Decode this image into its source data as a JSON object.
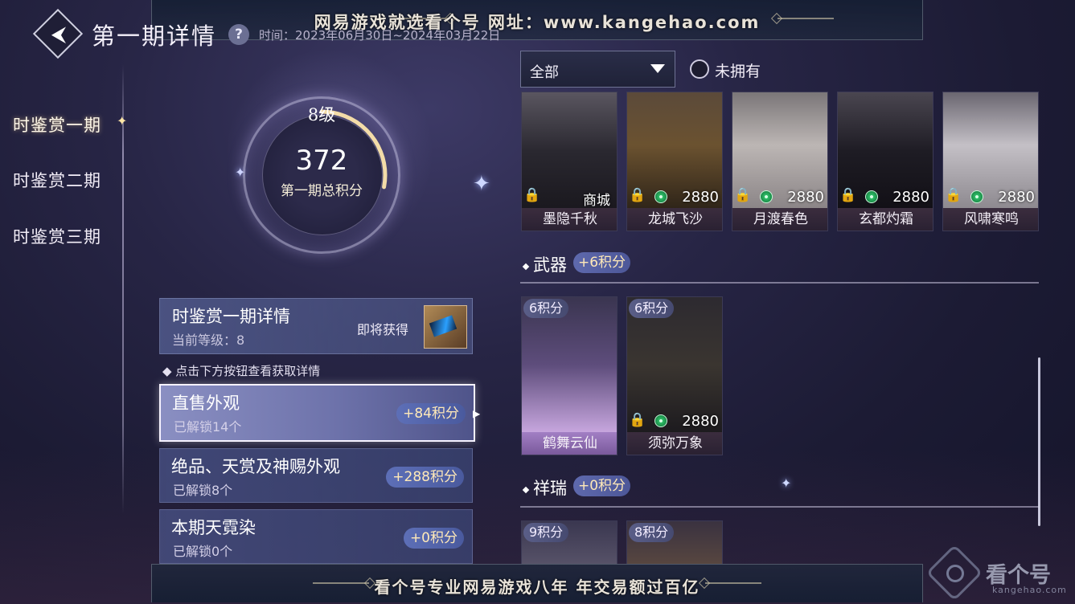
{
  "watermark_top": "网易游戏就选看个号   网址：www.kangehao.com",
  "watermark_bottom": "看个号专业网易游戏八年   年交易额过百亿",
  "watermark_logo": {
    "text": "看个号",
    "sub": "kangehao.com"
  },
  "header": {
    "title": "第一期详情",
    "help": "?",
    "date": "时间：2023年06月30日~2024年03月22日"
  },
  "tabs": [
    {
      "label": "时鉴赏一期",
      "active": true
    },
    {
      "label": "时鉴赏二期",
      "active": false
    },
    {
      "label": "时鉴赏三期",
      "active": false
    }
  ],
  "gauge": {
    "level": "8级",
    "score": "372",
    "label": "第一期总积分",
    "progress": 0.28
  },
  "info_card": {
    "title": "时鉴赏一期详情",
    "current_level": "当前等级：8",
    "soon": "即将获得"
  },
  "hint": "◆ 点击下方按钮查看获取详情",
  "categories": [
    {
      "name": "直售外观",
      "sub": "已解锁14个",
      "points": "+84积分",
      "active": true
    },
    {
      "name": "绝品、天赏及神赐外观",
      "sub": "已解锁8个",
      "points": "+288积分",
      "active": false
    },
    {
      "name": "本期天霓染",
      "sub": "已解锁0个",
      "points": "+0积分",
      "active": false
    }
  ],
  "filter": {
    "value": "全部",
    "not_owned": "未拥有"
  },
  "outfits": [
    {
      "name": "墨隐千秋",
      "price": "商城",
      "coin": false
    },
    {
      "name": "龙城飞沙",
      "price": "2880",
      "coin": true
    },
    {
      "name": "月渡春色",
      "price": "2880",
      "coin": true
    },
    {
      "name": "玄都灼霜",
      "price": "2880",
      "coin": true
    },
    {
      "name": "风啸寒鸣",
      "price": "2880",
      "coin": true
    }
  ],
  "weapon_section": {
    "title": "武器",
    "points": "+6积分"
  },
  "weapons": [
    {
      "name": "鹤舞云仙",
      "badge": "6积分",
      "price": "",
      "coin": false
    },
    {
      "name": "须弥万象",
      "badge": "6积分",
      "price": "2880",
      "coin": true
    }
  ],
  "auspicious_section": {
    "title": "祥瑞",
    "points": "+0积分"
  },
  "auspicious": [
    {
      "badge": "9积分"
    },
    {
      "badge": "8积分"
    }
  ],
  "colors": {
    "accent": "#ffe9b8",
    "panel": "#4f548a",
    "coin": "#2fbf68"
  },
  "icons": {
    "back": "back-arrow-icon",
    "lock": "lock-icon",
    "coin": "jade-coin-icon",
    "dropdown": "caret-down-icon"
  }
}
